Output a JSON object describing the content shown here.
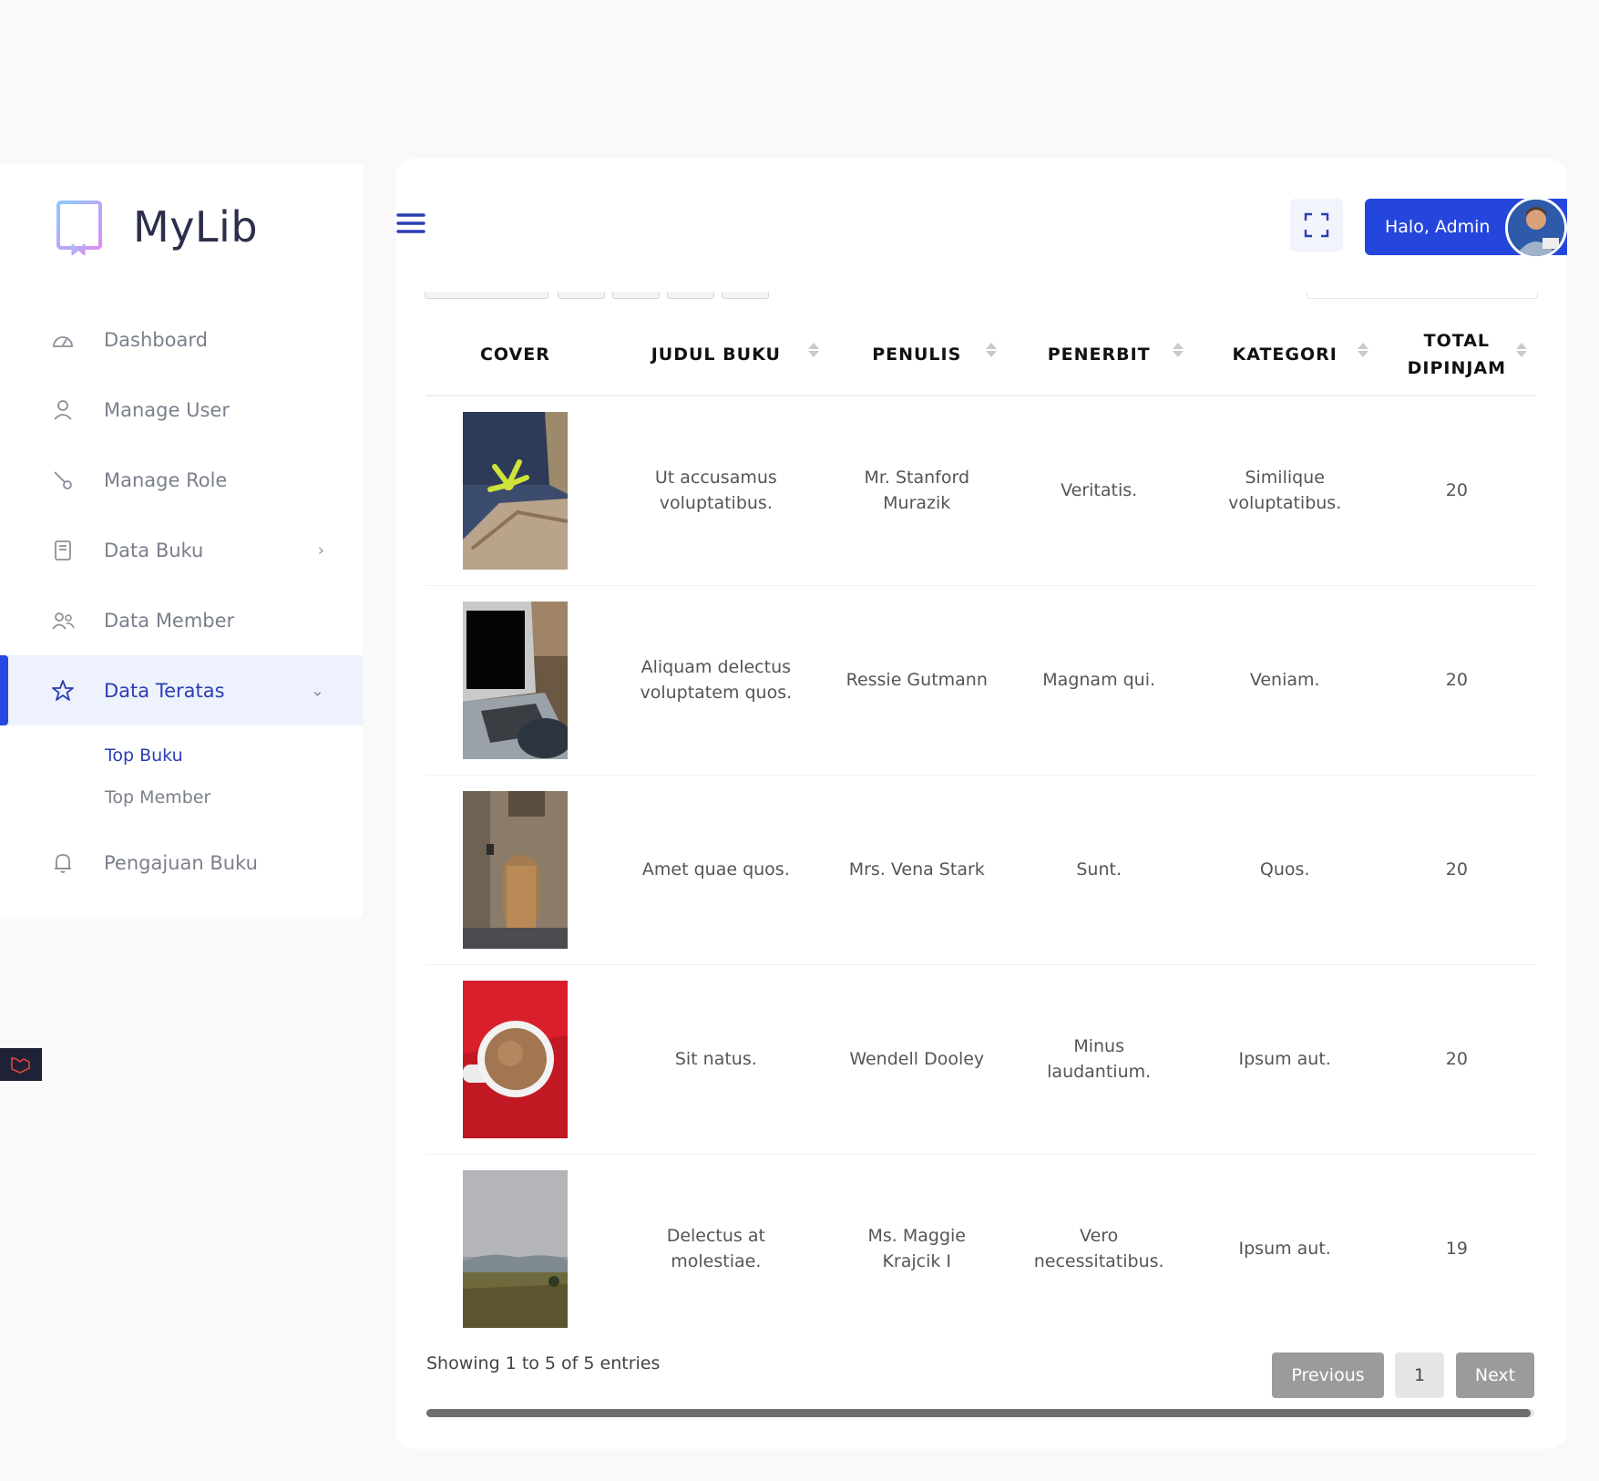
{
  "brand": {
    "name": "MyLib"
  },
  "sidebar": {
    "items": [
      {
        "label": "Dashboard",
        "icon": "dashboard-gauge-icon"
      },
      {
        "label": "Manage User",
        "icon": "user-icon"
      },
      {
        "label": "Manage Role",
        "icon": "key-icon"
      },
      {
        "label": "Data Buku",
        "icon": "book-icon"
      },
      {
        "label": "Data Member",
        "icon": "users-icon"
      },
      {
        "label": "Data Teratas",
        "icon": "star-icon"
      },
      {
        "label": "Pengajuan Buku",
        "icon": "bell-icon"
      }
    ],
    "submenu": [
      {
        "label": "Top Buku",
        "active": true
      },
      {
        "label": "Top Member",
        "active": false
      }
    ]
  },
  "header": {
    "user_label": "Halo, Admin"
  },
  "table": {
    "columns": [
      "COVER",
      "JUDUL BUKU",
      "PENULIS",
      "PENERBIT",
      "KATEGORI",
      "TOTAL DIPINJAM"
    ],
    "rows": [
      {
        "cover": "flower-on-rock",
        "judul": "Ut accusamus voluptatibus.",
        "penulis": "Mr. Stanford Murazik",
        "penerbit": "Veritatis.",
        "kategori": "Similique voluptatibus.",
        "total": "20"
      },
      {
        "cover": "laptop-typing",
        "judul": "Aliquam delectus voluptatem quos.",
        "penulis": "Ressie Gutmann",
        "penerbit": "Magnam qui.",
        "kategori": "Veniam.",
        "total": "20"
      },
      {
        "cover": "old-building-door",
        "judul": "Amet quae quos.",
        "penulis": "Mrs. Vena Stark",
        "penerbit": "Sunt.",
        "kategori": "Quos.",
        "total": "20"
      },
      {
        "cover": "coffee-cup-red",
        "judul": "Sit natus.",
        "penulis": "Wendell Dooley",
        "penerbit": "Minus laudantium.",
        "kategori": "Ipsum aut.",
        "total": "20"
      },
      {
        "cover": "cloudy-field",
        "judul": "Delectus at molestiae.",
        "penulis": "Ms. Maggie Krajcik I",
        "penerbit": "Vero necessitatibus.",
        "kategori": "Ipsum aut.",
        "total": "19"
      }
    ]
  },
  "footer": {
    "info": "Showing 1 to 5 of 5 entries",
    "prev": "Previous",
    "page": "1",
    "next": "Next"
  },
  "colors": {
    "primary": "#2546dc",
    "active_text": "#2c3eb3",
    "sidebar_active_bg": "#eef2fd"
  }
}
